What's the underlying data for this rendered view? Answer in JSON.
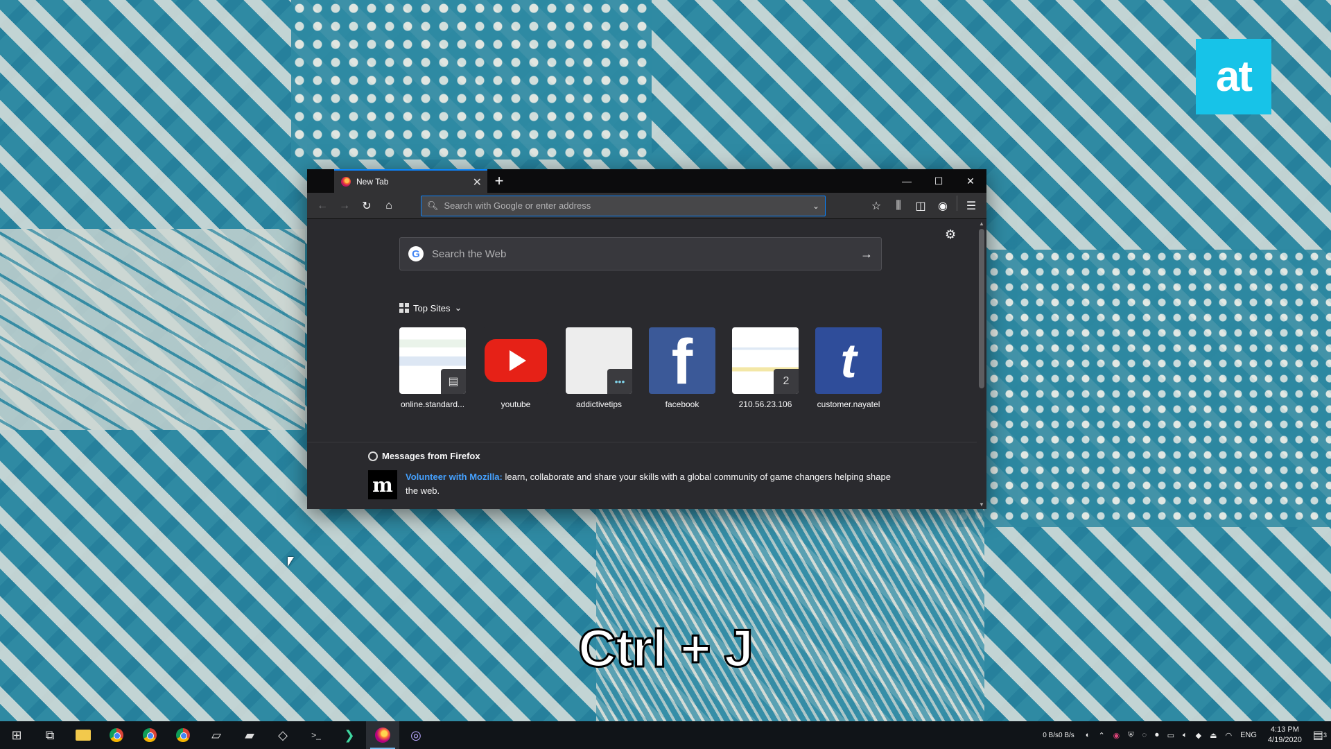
{
  "overlay": {
    "shortcut_caption": "Ctrl + J",
    "brand_logo_text": "at"
  },
  "browser": {
    "tab": {
      "title": "New Tab",
      "close_symbol": "✕",
      "new_tab_symbol": "+"
    },
    "window_controls": {
      "minimize": "—",
      "maximize": "☐",
      "close": "✕"
    },
    "toolbar": {
      "back": "←",
      "forward": "→",
      "reload": "↻",
      "home": "⌂",
      "urlbar_placeholder": "Search with Google or enter address",
      "urlbar_dropdown": "⌄",
      "bookmark": "☆",
      "library": "⫼",
      "sidebar": "◫",
      "account": "◉",
      "menu": "☰"
    }
  },
  "newtab": {
    "settings_symbol": "⚙",
    "search": {
      "logo": "G",
      "placeholder": "Search the Web",
      "arrow": "→"
    },
    "top_sites": {
      "heading": "Top Sites",
      "chevron": "⌄",
      "sites": [
        {
          "label": "online.standard...",
          "icon": "sheet-icon",
          "badge": ""
        },
        {
          "label": "youtube",
          "icon": "youtube-icon",
          "badge": ""
        },
        {
          "label": "addictivetips",
          "icon": "dots-icon",
          "badge": "•••"
        },
        {
          "label": "facebook",
          "icon": "facebook-icon",
          "badge": ""
        },
        {
          "label": "210.56.23.106",
          "icon": "number-badge",
          "badge": "2"
        },
        {
          "label": "customer.nayatel",
          "icon": "nayatel-icon",
          "badge": ""
        }
      ],
      "facebook_glyph": "f",
      "nayatel_glyph": "t"
    },
    "messages": {
      "heading": "Messages from Firefox",
      "logo": "m",
      "link_text": "Volunteer with Mozilla:",
      "body": "learn, collaborate and share your skills with a global community of game changers helping shape the web."
    }
  },
  "taskbar": {
    "net_up": "0 B/s",
    "net_down": "0 B/s",
    "language": "ENG",
    "time": "4:13 PM",
    "date": "4/19/2020",
    "notifications": "3",
    "start_symbol": "⊞",
    "taskview_symbol": "⧉",
    "terminal_symbol": ">_"
  },
  "colors": {
    "accent": "#0a84ff",
    "urlbar_border": "#0a84ff",
    "link": "#45a1ff",
    "at_logo": "#17c3e8"
  }
}
